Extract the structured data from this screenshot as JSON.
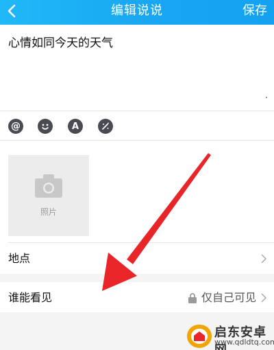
{
  "header": {
    "title": "编辑说说",
    "save_label": "保存"
  },
  "editor": {
    "text": "心情如同今天的天气"
  },
  "toolbar": {
    "icons": [
      "at-icon",
      "emoji-icon",
      "font-icon",
      "magic-wand-icon"
    ],
    "font_glyph": "A",
    "at_glyph": "@"
  },
  "photo": {
    "label": "照片"
  },
  "location": {
    "label": "地点"
  },
  "visibility": {
    "label": "谁能看见",
    "value": "仅自己可见"
  },
  "watermark": {
    "name": "启东安卓网",
    "url": "www.qdldtq.com"
  },
  "colors": {
    "header": "#18a7f2",
    "arrow": "#e8262a",
    "icon": "#4a4a52"
  }
}
